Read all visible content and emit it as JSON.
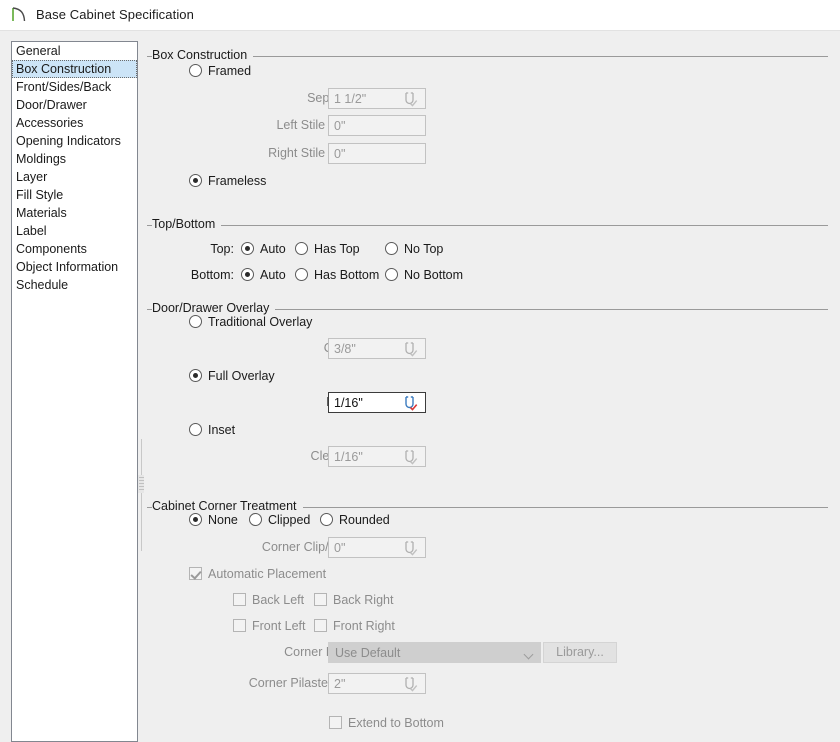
{
  "window": {
    "title": "Base Cabinet Specification",
    "icon": "cabinet-door-swing-icon"
  },
  "sidebar": {
    "items": [
      {
        "label": "General",
        "selected": false
      },
      {
        "label": "Box Construction",
        "selected": true
      },
      {
        "label": "Front/Sides/Back",
        "selected": false
      },
      {
        "label": "Door/Drawer",
        "selected": false
      },
      {
        "label": "Accessories",
        "selected": false
      },
      {
        "label": "Opening Indicators",
        "selected": false
      },
      {
        "label": "Moldings",
        "selected": false
      },
      {
        "label": "Layer",
        "selected": false
      },
      {
        "label": "Fill Style",
        "selected": false
      },
      {
        "label": "Materials",
        "selected": false
      },
      {
        "label": "Label",
        "selected": false
      },
      {
        "label": "Components",
        "selected": false
      },
      {
        "label": "Object Information",
        "selected": false
      },
      {
        "label": "Schedule",
        "selected": false
      }
    ]
  },
  "box_construction": {
    "group_title": "Box Construction",
    "framed_label": "Framed",
    "framed_selected": false,
    "frameless_label": "Frameless",
    "frameless_selected": true,
    "separation_label": "Separation:",
    "separation_value": "1 1/2\"",
    "left_stile_label": "Left Stile Extend:",
    "left_stile_value": "0\"",
    "right_stile_label": "Right Stile Extend:",
    "right_stile_value": "0\""
  },
  "top_bottom": {
    "group_title": "Top/Bottom",
    "top_label": "Top:",
    "top_options": [
      "Auto",
      "Has Top",
      "No Top"
    ],
    "top_selected": "Auto",
    "bottom_label": "Bottom:",
    "bottom_options": [
      "Auto",
      "Has Bottom",
      "No Bottom"
    ],
    "bottom_selected": "Auto"
  },
  "overlay": {
    "group_title": "Door/Drawer Overlay",
    "traditional_label": "Traditional Overlay",
    "traditional_selected": false,
    "overlap_label": "Overlap:",
    "overlap_value": "3/8\"",
    "full_label": "Full Overlay",
    "full_selected": true,
    "reveal_label": "Reveal:",
    "reveal_value": "1/16\"",
    "inset_label": "Inset",
    "inset_selected": false,
    "clearance_label": "Clearance:",
    "clearance_value": "1/16\""
  },
  "corner": {
    "group_title": "Cabinet Corner Treatment",
    "treatment_options": [
      "None",
      "Clipped",
      "Rounded"
    ],
    "treatment_selected": "None",
    "clip_radius_label": "Corner Clip/Radius:",
    "clip_radius_value": "0\"",
    "auto_placement_label": "Automatic Placement",
    "auto_placement_checked": true,
    "back_left_label": "Back Left",
    "back_left_checked": false,
    "back_right_label": "Back Right",
    "back_right_checked": false,
    "front_left_label": "Front Left",
    "front_left_checked": false,
    "front_right_label": "Front Right",
    "front_right_checked": false,
    "pilaster_label": "Corner Pilaster:",
    "pilaster_value": "Use Default",
    "library_button": "Library...",
    "pilaster_width_label": "Corner Pilaster Width:",
    "pilaster_width_value": "2\"",
    "extend_bottom_label": "Extend to Bottom",
    "extend_bottom_checked": false
  },
  "colors": {
    "selection_blue": "#cce4f7",
    "dialog_bg": "#efefef",
    "disabled_text": "#8c8c8c",
    "spinner_blue": "#3b7bbf",
    "spinner_red": "#d83535"
  }
}
